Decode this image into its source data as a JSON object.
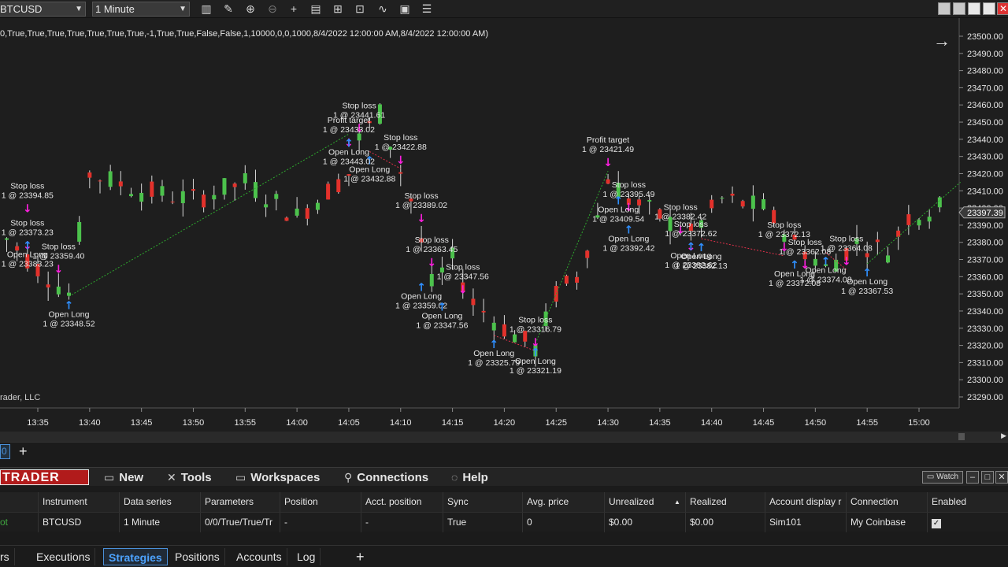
{
  "toolbar": {
    "instrument": "BTCUSD",
    "interval": "1 Minute",
    "icons": [
      "bar-type-icon",
      "draw-icon",
      "zoom-in-icon",
      "zoom-out-icon",
      "crosshair-icon",
      "data-box-icon",
      "templates-icon",
      "strategies-icon",
      "indicators-icon",
      "properties-icon",
      "list-icon"
    ]
  },
  "chart": {
    "params_text": "0,True,True,True,True,True,True,True,-1,True,True,False,False,1,10000,0,0,1000,8/4/2022 12:00:00 AM,8/4/2022 12:00:00 AM)",
    "copyright": "rader, LLC",
    "current_price": "23397.39",
    "colors": {
      "up": "#4cc24c",
      "down": "#e3312b",
      "background": "#1e1e1e",
      "entry_arrow": "#2f8fff",
      "exit_arrow": "#ff1fe0"
    }
  },
  "chart_data": {
    "type": "candlestick",
    "y_ticks": [
      "23500.00",
      "23490.00",
      "23480.00",
      "23470.00",
      "23460.00",
      "23450.00",
      "23440.00",
      "23430.00",
      "23420.00",
      "23410.00",
      "23400.00",
      "23390.00",
      "23380.00",
      "23370.00",
      "23360.00",
      "23350.00",
      "23340.00",
      "23330.00",
      "23320.00",
      "23310.00",
      "23300.00",
      "23290.00"
    ],
    "x_ticks": [
      "13:35",
      "13:40",
      "13:45",
      "13:50",
      "13:55",
      "14:00",
      "14:05",
      "14:10",
      "14:15",
      "14:20",
      "14:25",
      "14:30",
      "14:35",
      "14:40",
      "14:45",
      "14:50",
      "14:55",
      "15:00"
    ],
    "ylim": [
      23285,
      23503
    ],
    "annotations": [
      {
        "label": "Stop loss",
        "value": "1 @ 23394.85",
        "t": "13:34",
        "y": 23394.85,
        "kind": "exit"
      },
      {
        "label": "Stop loss",
        "value": "1 @ 23373.23",
        "t": "13:34",
        "y": 23373.23,
        "kind": "exit"
      },
      {
        "label": "Stop loss",
        "value": "1 @ 23359.40",
        "t": "13:37",
        "y": 23359.4,
        "kind": "exit"
      },
      {
        "label": "Open Long",
        "value": "1 @ 23383.23",
        "t": "13:34",
        "y": 23383.23,
        "kind": "entry"
      },
      {
        "label": "Open Long",
        "value": "1 @ 23348.52",
        "t": "13:38",
        "y": 23348.52,
        "kind": "entry"
      },
      {
        "label": "Stop loss",
        "value": "1 @ 23441.61",
        "t": "14:06",
        "y": 23441.61,
        "kind": "exit"
      },
      {
        "label": "Profit target",
        "value": "1 @ 23433.02",
        "t": "14:05",
        "y": 23433.02,
        "kind": "exit"
      },
      {
        "label": "Stop loss",
        "value": "1 @ 23422.88",
        "t": "14:10",
        "y": 23422.88,
        "kind": "exit"
      },
      {
        "label": "Open Long",
        "value": "1 @ 23432.88",
        "t": "14:07",
        "y": 23432.88,
        "kind": "entry"
      },
      {
        "label": "Open Long",
        "value": "1 @ 23443.02",
        "t": "14:05",
        "y": 23443.02,
        "kind": "entry"
      },
      {
        "label": "Stop loss",
        "value": "1 @ 23389.02",
        "t": "14:12",
        "y": 23389.02,
        "kind": "exit"
      },
      {
        "label": "Stop loss",
        "value": "1 @ 23363.45",
        "t": "14:13",
        "y": 23363.45,
        "kind": "exit"
      },
      {
        "label": "Stop loss",
        "value": "1 @ 23347.56",
        "t": "14:16",
        "y": 23347.56,
        "kind": "exit"
      },
      {
        "label": "Open Long",
        "value": "1 @ 23359.02",
        "t": "14:12",
        "y": 23359.02,
        "kind": "entry"
      },
      {
        "label": "Open Long",
        "value": "1 @ 23347.56",
        "t": "14:14",
        "y": 23347.56,
        "kind": "entry"
      },
      {
        "label": "Open Long",
        "value": "1 @ 23325.79",
        "t": "14:19",
        "y": 23325.79,
        "kind": "entry"
      },
      {
        "label": "Stop loss",
        "value": "1 @ 23316.79",
        "t": "14:23",
        "y": 23316.79,
        "kind": "exit"
      },
      {
        "label": "Open Long",
        "value": "1 @ 23321.19",
        "t": "14:23",
        "y": 23321.19,
        "kind": "entry"
      },
      {
        "label": "Profit target",
        "value": "1 @ 23421.49",
        "t": "14:30",
        "y": 23421.49,
        "kind": "exit"
      },
      {
        "label": "Stop loss",
        "value": "1 @ 23395.49",
        "t": "14:32",
        "y": 23395.49,
        "kind": "exit"
      },
      {
        "label": "Open Long",
        "value": "1 @ 23409.54",
        "t": "14:31",
        "y": 23409.54,
        "kind": "entry"
      },
      {
        "label": "Open Long",
        "value": "1 @ 23392.42",
        "t": "14:32",
        "y": 23392.42,
        "kind": "entry"
      },
      {
        "label": "Stop loss",
        "value": "1 @ 23382.42",
        "t": "14:37",
        "y": 23382.42,
        "kind": "exit"
      },
      {
        "label": "Stop loss",
        "value": "1 @ 23372.62",
        "t": "14:38",
        "y": 23372.62,
        "kind": "exit"
      },
      {
        "label": "Open Long",
        "value": "1 @ 23382.13",
        "t": "14:39",
        "y": 23382.13,
        "kind": "entry"
      },
      {
        "label": "Open Long",
        "value": "1 @ 23382.62",
        "t": "14:38",
        "y": 23382.62,
        "kind": "entry"
      },
      {
        "label": "Stop loss",
        "value": "1 @ 23372.13",
        "t": "14:47",
        "y": 23372.13,
        "kind": "exit"
      },
      {
        "label": "Stop loss",
        "value": "1 @ 23362.08",
        "t": "14:49",
        "y": 23362.08,
        "kind": "exit"
      },
      {
        "label": "Stop loss",
        "value": "1 @ 23364.08",
        "t": "14:53",
        "y": 23364.08,
        "kind": "exit"
      },
      {
        "label": "Open Long",
        "value": "1 @ 23372.08",
        "t": "14:48",
        "y": 23372.08,
        "kind": "entry"
      },
      {
        "label": "Open Long",
        "value": "1 @ 23374.08",
        "t": "14:51",
        "y": 23374.08,
        "kind": "entry"
      },
      {
        "label": "Open Long",
        "value": "1 @ 23367.53",
        "t": "14:55",
        "y": 23367.53,
        "kind": "entry"
      }
    ]
  },
  "tabs": {
    "active": "0",
    "add": "+"
  },
  "control_center": {
    "logo": "TRADER",
    "menu": [
      {
        "icon": "new-icon",
        "label": "New"
      },
      {
        "icon": "tools-icon",
        "label": "Tools"
      },
      {
        "icon": "workspaces-icon",
        "label": "Workspaces"
      },
      {
        "icon": "connections-icon",
        "label": "Connections"
      },
      {
        "icon": "help-icon",
        "label": "Help"
      }
    ],
    "watch": "Watch",
    "grid": {
      "headers": [
        "Instrument",
        "Data series",
        "Parameters",
        "Position",
        "Acct. position",
        "Sync",
        "Avg. price",
        "Unrealized",
        "Realized",
        "Account display r",
        "Connection",
        "Enabled"
      ],
      "row": {
        "prefix": "ot",
        "cells": [
          "BTCUSD",
          "1 Minute",
          "0/0/True/True/Tr",
          "-",
          "-",
          "True",
          "0",
          "$0.00",
          "$0.00",
          "Sim101",
          "My Coinbase"
        ],
        "enabled": true
      }
    },
    "bottom_tabs": [
      "rs",
      "Executions",
      "Strategies",
      "Positions",
      "Accounts",
      "Log",
      "+"
    ],
    "active_bottom_tab": "Strategies"
  }
}
